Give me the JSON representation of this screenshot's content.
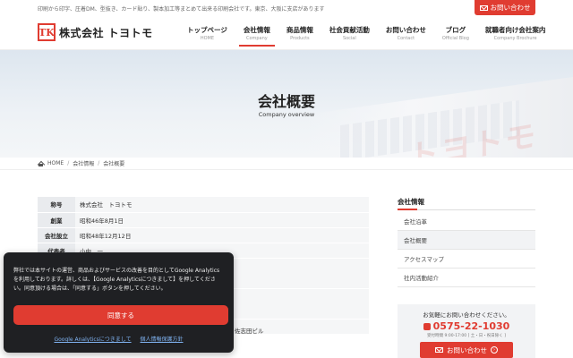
{
  "topbar": {
    "tagline": "印刷から印字、圧着DM、型抜き、カード貼り、製本加工等まとめて出来る印刷会社です。東京、大阪に支店があります",
    "contact_label": "お問い合わせ"
  },
  "header": {
    "logo_mark": "TK",
    "logo_text": "株式会社 トヨトモ",
    "nav": [
      {
        "jp": "トップページ",
        "en": "HOME"
      },
      {
        "jp": "会社情報",
        "en": "Company"
      },
      {
        "jp": "商品情報",
        "en": "Products"
      },
      {
        "jp": "社会貢献活動",
        "en": "Social"
      },
      {
        "jp": "お問い合わせ",
        "en": "Contact"
      },
      {
        "jp": "ブログ",
        "en": "Official Blog"
      },
      {
        "jp": "就職者向け会社案内",
        "en": "Company Brochure"
      }
    ]
  },
  "hero": {
    "title": "会社概要",
    "subtitle": "Company overview",
    "sign_text": "トヨトモ"
  },
  "breadcrumb": {
    "home": "HOME",
    "level1": "会社情報",
    "current": "会社概要"
  },
  "company_table": [
    {
      "label": "称号",
      "value": "株式会社　トヨトモ"
    },
    {
      "label": "創業",
      "value": "昭和46年8月1日"
    },
    {
      "label": "会社設立",
      "value": "昭和48年12月12日"
    },
    {
      "label": "代表者",
      "value": "小中　一"
    }
  ],
  "sidebar": {
    "title": "会社情報",
    "items": [
      "会社沿革",
      "会社概要",
      "アクセスマップ",
      "社内活動紹介"
    ]
  },
  "contact_box": {
    "lead": "お気軽にお問い合わせください。",
    "phone": "0575-22-1030",
    "hours": "受付時間 9:00-17:00 [ 土・日・祝日除く ]",
    "button": "お問い合わせ"
  },
  "cookie": {
    "message": "弊社では本サイトの運営、商品およびサービスの改善を目的としてGoogle Analyticsを利用しております。詳しくは、【Google Analyticsにつきまして】を押してください。同意頂ける場合は、「同意する」ボタンを押してください。",
    "agree": "同意する",
    "link1": "Google Analyticsにつきまして",
    "link2": "個人情報保護方針"
  },
  "peek_text": "佐志田ビル",
  "colors": {
    "accent": "#e03c31",
    "banner": "#1f2023"
  }
}
